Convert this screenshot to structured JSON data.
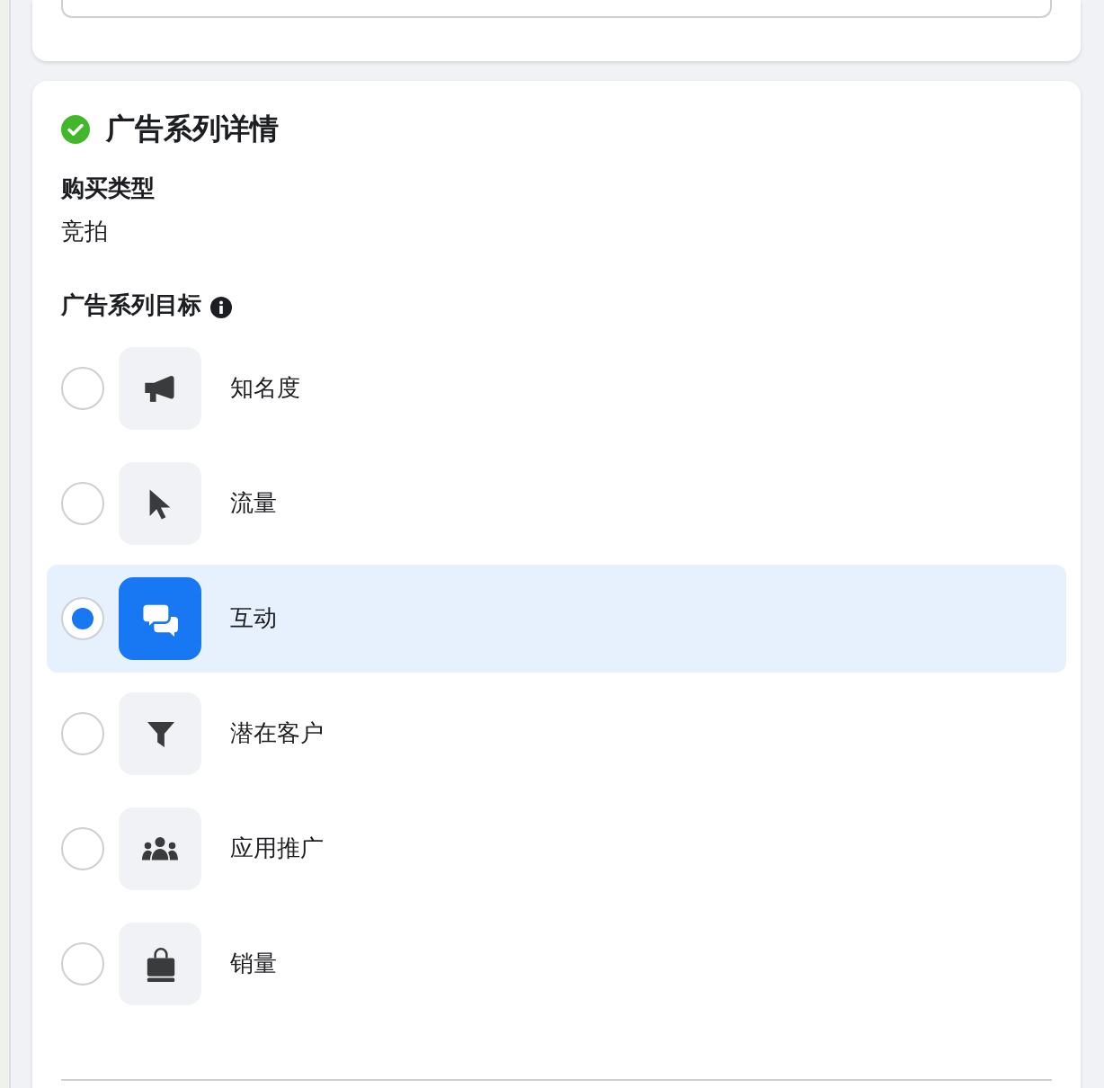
{
  "campaign_details": {
    "title": "广告系列详情",
    "complete": true,
    "buying_type": {
      "label": "购买类型",
      "value": "竞拍"
    },
    "objective": {
      "label": "广告系列目标",
      "options": [
        {
          "label": "知名度",
          "kind": "megaphone",
          "selected": false
        },
        {
          "label": "流量",
          "kind": "cursor",
          "selected": false
        },
        {
          "label": "互动",
          "kind": "chat",
          "selected": true
        },
        {
          "label": "潜在客户",
          "kind": "funnel",
          "selected": false
        },
        {
          "label": "应用推广",
          "kind": "people",
          "selected": false
        },
        {
          "label": "销量",
          "kind": "bag",
          "selected": false
        }
      ]
    }
  }
}
